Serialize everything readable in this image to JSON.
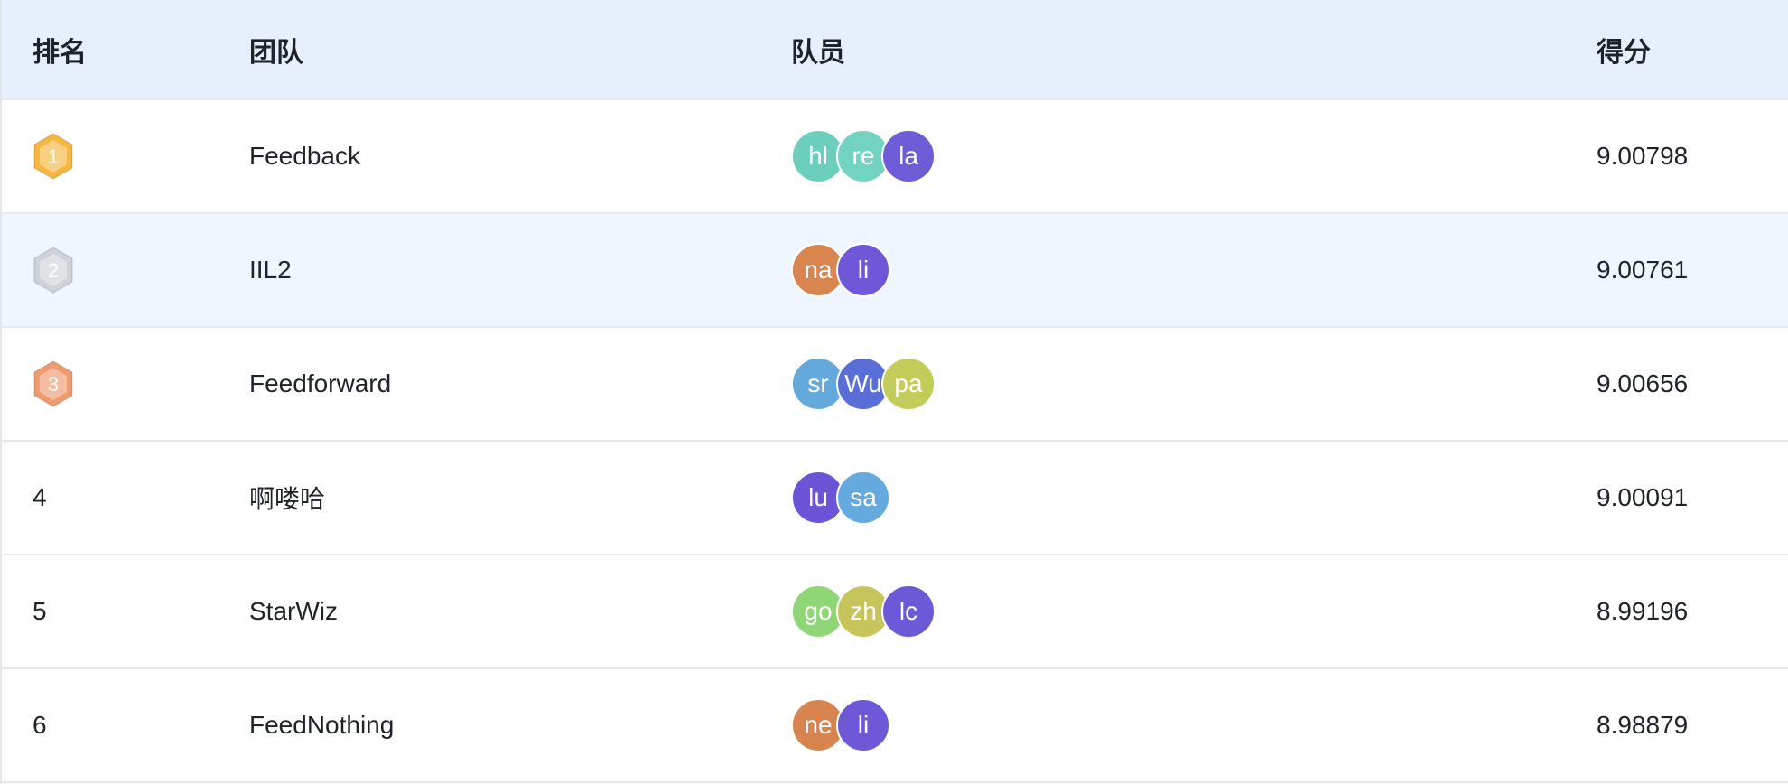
{
  "header": {
    "rank": "排名",
    "team": "团队",
    "members": "队员",
    "score": "得分"
  },
  "colors": {
    "header_bg": "#e8effc",
    "hover_row_bg": "#f0f6ff",
    "gold": "#f5b73f",
    "silver": "#cfd3d8",
    "bronze": "#ef9a6f"
  },
  "rows": [
    {
      "rank": "1",
      "medal": "gold",
      "team": "Feedback",
      "score": "9.00798",
      "members": [
        {
          "initials": "hl",
          "color": "#6ccfbd"
        },
        {
          "initials": "re",
          "color": "#72d3c0"
        },
        {
          "initials": "la",
          "color": "#6c5dd6"
        }
      ]
    },
    {
      "rank": "2",
      "medal": "silver",
      "team": "IIL2",
      "score": "9.00761",
      "members": [
        {
          "initials": "na",
          "color": "#d9854f"
        },
        {
          "initials": "li",
          "color": "#6f58d8"
        }
      ]
    },
    {
      "rank": "3",
      "medal": "bronze",
      "team": "Feedforward",
      "score": "9.00656",
      "members": [
        {
          "initials": "sr",
          "color": "#63a9dc"
        },
        {
          "initials": "Wu",
          "color": "#5a6ed8"
        },
        {
          "initials": "pa",
          "color": "#c2cc58"
        }
      ]
    },
    {
      "rank": "4",
      "medal": "",
      "team": "啊喽哈",
      "score": "9.00091",
      "members": [
        {
          "initials": "lu",
          "color": "#6b55d6"
        },
        {
          "initials": "sa",
          "color": "#64aadf"
        }
      ]
    },
    {
      "rank": "5",
      "medal": "",
      "team": "StarWiz",
      "score": "8.99196",
      "members": [
        {
          "initials": "go",
          "color": "#8fd776"
        },
        {
          "initials": "zh",
          "color": "#c7c45c"
        },
        {
          "initials": "lc",
          "color": "#6b5ad8"
        }
      ]
    },
    {
      "rank": "6",
      "medal": "",
      "team": "FeedNothing",
      "score": "8.98879",
      "members": [
        {
          "initials": "ne",
          "color": "#d8844f"
        },
        {
          "initials": "li",
          "color": "#6f58d8"
        }
      ]
    }
  ]
}
